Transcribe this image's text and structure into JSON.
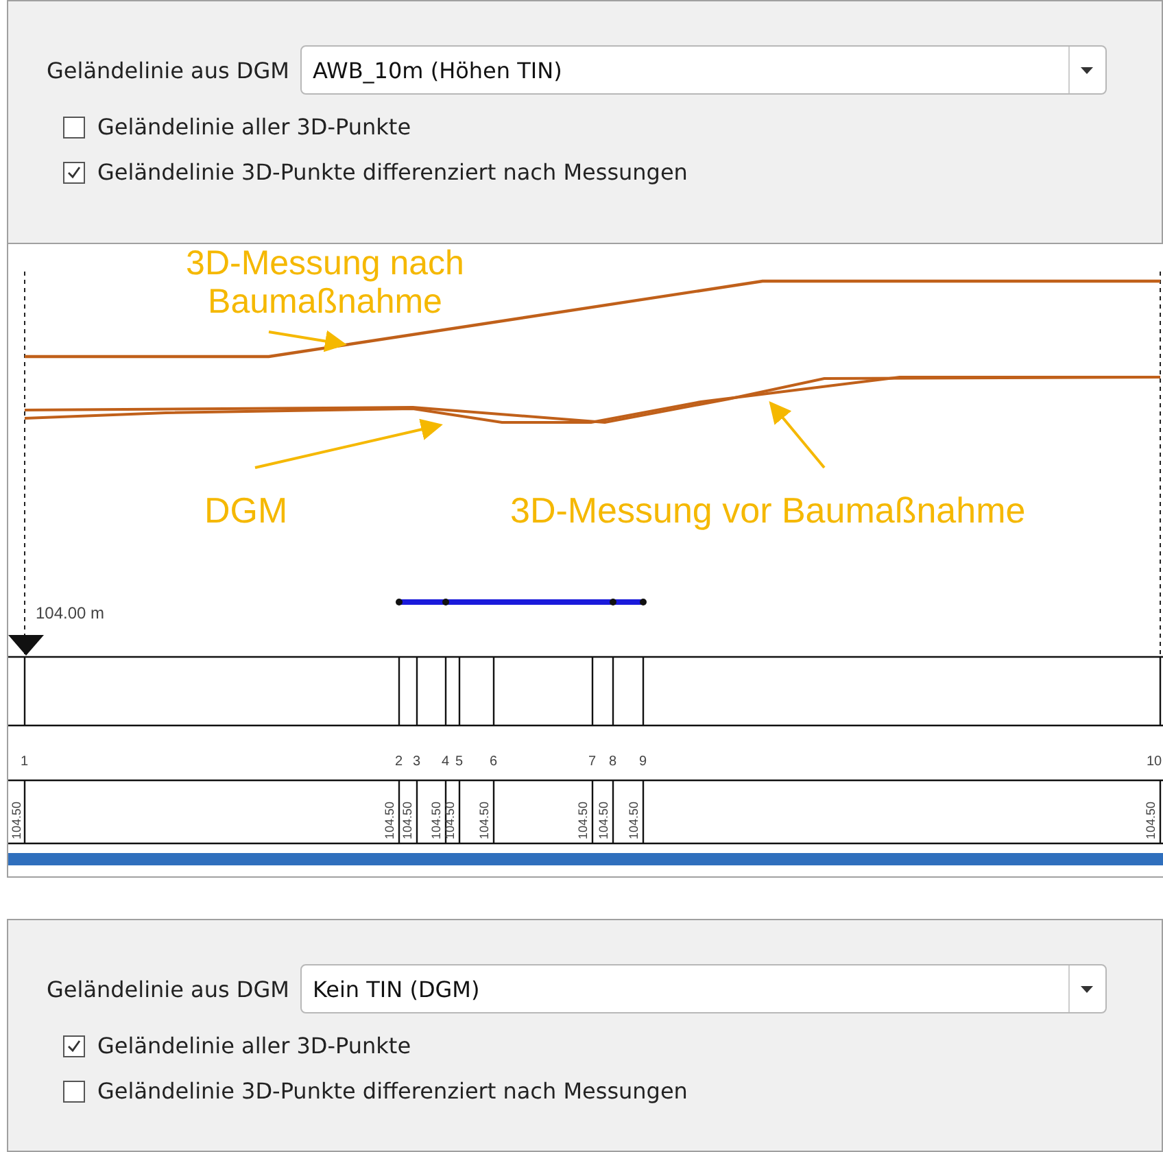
{
  "panels": [
    {
      "dgm_label": "Geländelinie aus DGM",
      "dropdown": {
        "value": "AWB_10m (Höhen TIN)"
      },
      "checkboxes": [
        {
          "label": "Geländelinie aller 3D-Punkte",
          "checked": false
        },
        {
          "label": "Geländelinie 3D-Punkte differenziert nach Messungen",
          "checked": true
        }
      ]
    },
    {
      "dgm_label": "Geländelinie aus DGM",
      "dropdown": {
        "value": "Kein TIN (DGM)"
      },
      "checkboxes": [
        {
          "label": "Geländelinie aller 3D-Punkte",
          "checked": true
        },
        {
          "label": "Geländelinie 3D-Punkte differenziert nach Messungen",
          "checked": false
        }
      ]
    }
  ],
  "profile": {
    "annotations": [
      "3D-Messung nach Baumaßnahme",
      "DGM",
      "3D-Messung vor Baumaßnahme"
    ],
    "reference_height": "104.00 m",
    "stations": [
      {
        "number": "1",
        "elevation": "104.50"
      },
      {
        "number": "2",
        "elevation": "104.50"
      },
      {
        "number": "3",
        "elevation": "104.50"
      },
      {
        "number": "4",
        "elevation": "104.50"
      },
      {
        "number": "5",
        "elevation": "104.50"
      },
      {
        "number": "6",
        "elevation": "104.50"
      },
      {
        "number": "7",
        "elevation": "104.50"
      },
      {
        "number": "8",
        "elevation": "104.50"
      },
      {
        "number": "9",
        "elevation": "104.50"
      },
      {
        "number": "10",
        "elevation": "104.50"
      }
    ]
  }
}
